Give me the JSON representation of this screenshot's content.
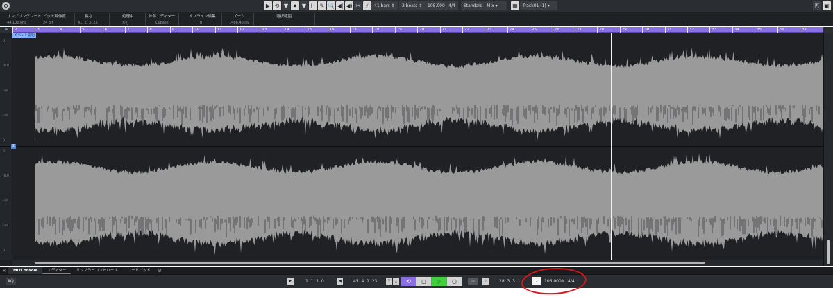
{
  "toolbar": {
    "app_icon": "cubase-logo-icon",
    "tool_buttons": [
      "▶",
      "⟲",
      "⏺",
      "▼",
      "⊢",
      "✎",
      "🔍",
      "◀|",
      "◀)",
      "✂",
      "⚡"
    ],
    "snap_icon": "♩",
    "length_value": "41 bars",
    "beats_value": "3 beats",
    "tempo_value": "105.000",
    "signature_value": "4/4",
    "mode_value": "Standard - Mix",
    "track_value": "Track01 (1)",
    "right_icons": [
      "⇱",
      "▣"
    ]
  },
  "info_line": [
    {
      "label": "サンプリングレート",
      "value": "44.100   kHz"
    },
    {
      "label": "ビット解像度",
      "value": "24     bit"
    },
    {
      "label": "長さ",
      "value": "41. 2. 3. 25"
    },
    {
      "label": "処理中",
      "value": "なし"
    },
    {
      "label": "外部エディター",
      "value": "Cubase"
    },
    {
      "label": "オフライン編集",
      "value": "0"
    },
    {
      "label": "ズーム",
      "value": "1466.400%"
    },
    {
      "label": "選択範囲",
      "value": ""
    }
  ],
  "ruler": {
    "gutter_symbol": "⊕",
    "marks": [
      "2",
      "3",
      "4",
      "5",
      "6",
      "7",
      "8",
      "9",
      "10",
      "11",
      "12",
      "13",
      "14",
      "15",
      "16",
      "17",
      "18",
      "19",
      "20",
      "21",
      "22",
      "23",
      "24",
      "25",
      "26",
      "27",
      "28",
      "29",
      "30",
      "31",
      "32",
      "33",
      "34",
      "35",
      "36",
      "37"
    ]
  },
  "event_label": "イベント開始",
  "scale_labels_top": [
    "0",
    "-6.0",
    "-12",
    "-inf",
    "-12",
    "-6.0",
    "0"
  ],
  "scale_labels_bottom": [
    "0",
    "-6.0",
    "-12",
    "-inf",
    "-12",
    "-6.0",
    "0"
  ],
  "zoom_box": "2",
  "lower_zone": {
    "close": "✕",
    "tabs": [
      "MixConsole",
      "エディター",
      "サンプラーコントロール",
      "コードパッド"
    ],
    "active_tab": 0,
    "selected_tab": 1,
    "gear": "⚙"
  },
  "transport": {
    "aq_label": "AQ",
    "left_locator": "1. 1. 1.   0",
    "right_locator": "45. 4. 1. 23",
    "position": "28. 3. 3.  1",
    "tempo": "105.000",
    "signature": "4/4",
    "buttons": {
      "cycle": "⟲",
      "stop": "◻",
      "play": "▷",
      "record": "○"
    },
    "tempo_icon": "♩"
  },
  "colors": {
    "ruler": "#8a6fe0",
    "play": "#3fcf3f",
    "waveform": "#9a9a9a",
    "background": "#1f2124",
    "annotation_circle": "#d9141b"
  }
}
